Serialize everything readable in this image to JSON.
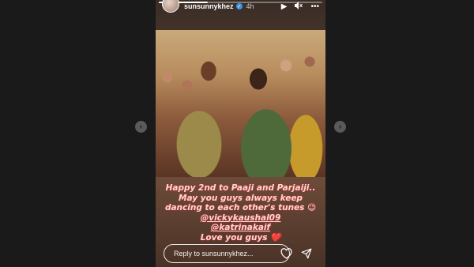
{
  "story": {
    "username": "sunsunnykhez",
    "verified_glyph": "✓",
    "time": "4h",
    "progress": 0.3,
    "controls": {
      "play_icon": "▶",
      "mute_icon": "🔇",
      "more_icon": "•••"
    }
  },
  "caption": {
    "line1": "Happy 2nd to Paaji and Parjaiji..",
    "line2": "May you guys always keep",
    "line3": "dancing to each other's tunes 😉",
    "mention1": "@vickykaushal09",
    "mention2": "@katrinakaif",
    "line_last": "Love you guys ❤️"
  },
  "reply": {
    "placeholder": "Reply to sunsunnykhez..."
  },
  "nav": {
    "prev_icon": "‹",
    "next_icon": "›"
  }
}
